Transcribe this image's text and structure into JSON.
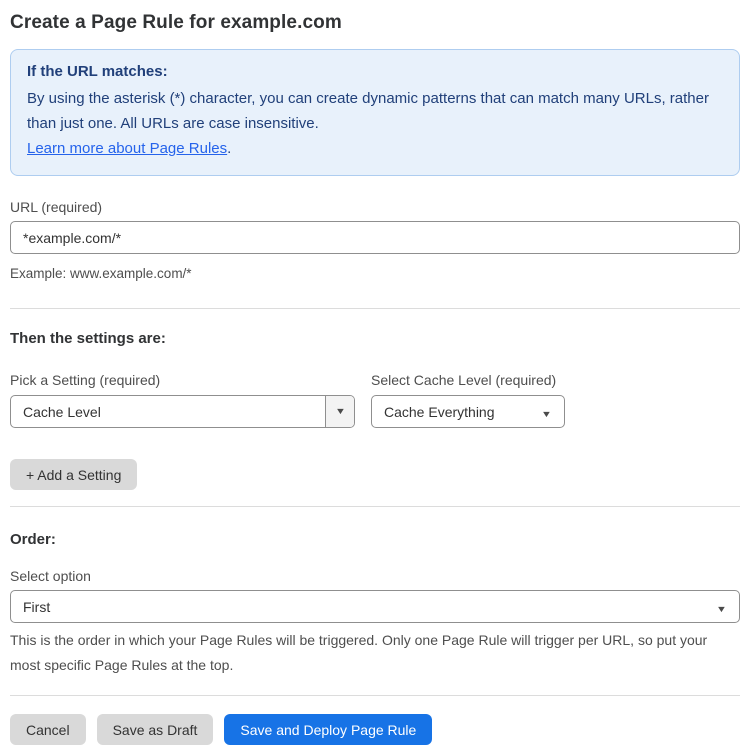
{
  "page": {
    "title": "Create a Page Rule for example.com"
  },
  "info_box": {
    "heading": "If the URL matches:",
    "body": "By using the asterisk (*) character, you can create dynamic patterns that can match many URLs, rather than just one. All URLs are case insensitive.",
    "link_label": "Learn more about Page Rules",
    "link_suffix": "."
  },
  "url_field": {
    "label": "URL (required)",
    "value": "*example.com/*",
    "helper": "Example: www.example.com/*"
  },
  "settings": {
    "heading": "Then the settings are:",
    "setting_select": {
      "label": "Pick a Setting (required)",
      "value": "Cache Level"
    },
    "cache_level_select": {
      "label": "Select Cache Level (required)",
      "value": "Cache Everything"
    },
    "add_setting_label": "+ Add a Setting"
  },
  "order": {
    "heading": "Order:",
    "select_label": "Select option",
    "value": "First",
    "helper": "This is the order in which your Page Rules will be triggered. Only one Page Rule will trigger per URL, so put your most specific Page Rules at the top."
  },
  "actions": {
    "cancel": "Cancel",
    "save_draft": "Save as Draft",
    "save_deploy": "Save and Deploy Page Rule"
  },
  "colors": {
    "info_bg": "#e8f1fb",
    "info_border": "#aecdf0",
    "info_text": "#21407a",
    "link": "#2563eb",
    "primary_button": "#1773e6",
    "gray_button": "#d9d9d9",
    "heading_text": "#313335",
    "label_text": "#4e4e4e",
    "input_border": "#8f8f8f",
    "divider": "#dcdcdc"
  },
  "icons": {
    "dropdown_arrow": "▼"
  }
}
